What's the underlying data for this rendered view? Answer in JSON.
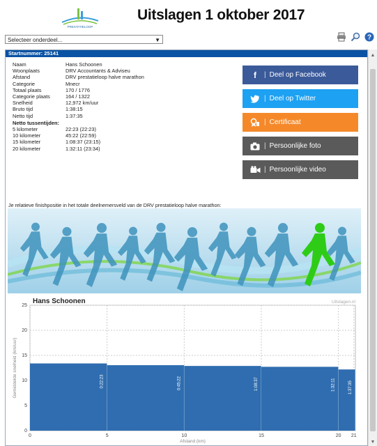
{
  "header": {
    "title": "Uitslagen 1 oktober 2017",
    "logo_text": "PRESTATIELOOP"
  },
  "selector": {
    "value": "Selecteer onderdeel..."
  },
  "tools": {
    "icons": [
      "print-icon",
      "search-icon",
      "help-icon"
    ]
  },
  "panel": {
    "heading": "Startnummer: 25141"
  },
  "athlete": {
    "rows": [
      {
        "label": "Naam",
        "value": "Hans Schoonen"
      },
      {
        "label": "Woonplaats",
        "value": "DRV Accountants & Adviseu"
      },
      {
        "label": "Afstand",
        "value": "DRV prestatieloop halve marathon"
      },
      {
        "label": "Categorie",
        "value": "Mnecr"
      },
      {
        "label": "Totaal plaats",
        "value": "170 / 1776"
      },
      {
        "label": "Categorie plaats",
        "value": "164 / 1322"
      },
      {
        "label": "Snelheid",
        "value": "12,972 km/uur"
      },
      {
        "label": "Bruto tijd",
        "value": "1:38:15"
      },
      {
        "label": "Netto tijd",
        "value": "1:37:35"
      }
    ],
    "splits_title": "Netto tussentijden:",
    "splits": [
      {
        "label": "5 kilometer",
        "value": "22:23 (22:23)"
      },
      {
        "label": "10 kilometer",
        "value": "45:22 (22:59)"
      },
      {
        "label": "15 kilometer",
        "value": "1:08:37 (23:15)"
      },
      {
        "label": "20 kilometer",
        "value": "1:32:11 (23:34)"
      }
    ]
  },
  "share": {
    "facebook": "Deel op Facebook",
    "twitter": "Deel op Twitter",
    "certificate": "Certificaat",
    "photo": "Persoonlijke foto",
    "video": "Persoonlijke video",
    "colors": {
      "facebook": "#3b5a9a",
      "twitter": "#1da1f2",
      "certificate": "#f5892a",
      "photo": "#5a5a5a",
      "video": "#5a5a5a"
    }
  },
  "note": "Je relatieve finishpositie in het totale deelnemersveld van de DRV prestatieloop halve marathon:",
  "chart_data": {
    "type": "area",
    "title": "Hans Schoonen",
    "corner_label": "Uitslagen.nl",
    "xlabel": "Afstand (km)",
    "ylabel": "Gemiddelde snelheid (km/uur)",
    "xlim": [
      0,
      21.1
    ],
    "ylim": [
      0,
      25
    ],
    "x_ticks": [
      0,
      5,
      10,
      15,
      20,
      21
    ],
    "y_ticks": [
      0,
      5,
      10,
      15,
      20,
      25
    ],
    "segments": [
      {
        "x0": 0,
        "x1": 5,
        "speed": 13.4,
        "label": "0:22:23"
      },
      {
        "x0": 5,
        "x1": 10,
        "speed": 13.05,
        "label": "0:45:22"
      },
      {
        "x0": 10,
        "x1": 15,
        "speed": 12.9,
        "label": "1:08:37"
      },
      {
        "x0": 15,
        "x1": 20,
        "speed": 12.73,
        "label": "1:32:11"
      },
      {
        "x0": 20,
        "x1": 21.1,
        "speed": 12.2,
        "label": "1:37:35"
      }
    ],
    "color": "#2f6db0"
  }
}
